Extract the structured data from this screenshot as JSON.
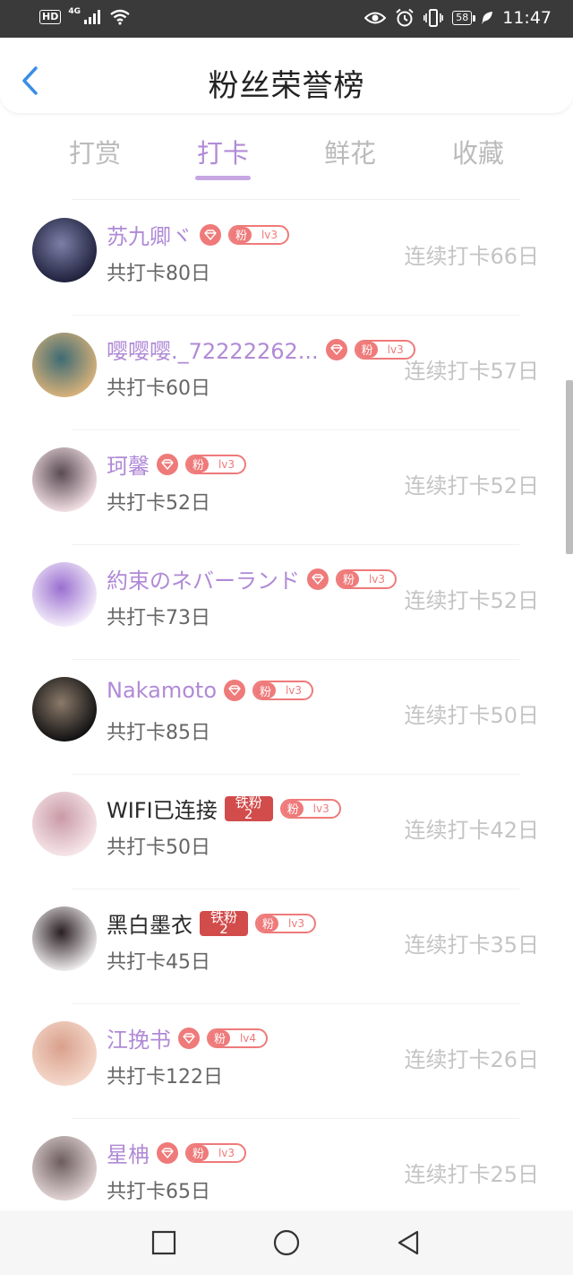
{
  "status_bar": {
    "left_hd": "HD",
    "left_network": "4G",
    "battery": "58",
    "time": "11:47"
  },
  "header": {
    "title": "粉丝荣誉榜"
  },
  "tabs": [
    {
      "label": "打赏",
      "active": false
    },
    {
      "label": "打卡",
      "active": true
    },
    {
      "label": "鲜花",
      "active": false
    },
    {
      "label": "收藏",
      "active": false
    }
  ],
  "badge": {
    "fan_text": "粉",
    "iron_line1": "铁粉",
    "iron_line2": "2"
  },
  "fans": [
    {
      "name": "苏九卿ヾ",
      "badge_type": "diamond",
      "level": "lv3",
      "total": "共打卡80日",
      "streak": "连续打卡66日",
      "avatar_colors": [
        "#1d1f3a",
        "#7d7fa8"
      ]
    },
    {
      "name": "嘤嘤嘤._72222262...",
      "badge_type": "diamond",
      "level": "lv3",
      "total": "共打卡60日",
      "streak": "连续打卡57日",
      "avatar_colors": [
        "#d9b27a",
        "#3e6b73"
      ]
    },
    {
      "name": "珂馨",
      "badge_type": "diamond",
      "level": "lv3",
      "total": "共打卡52日",
      "streak": "连续打卡52日",
      "avatar_colors": [
        "#f3e1e6",
        "#5a4a52"
      ]
    },
    {
      "name": "約束のネバーランド",
      "badge_type": "diamond",
      "level": "lv3",
      "total": "共打卡73日",
      "streak": "连续打卡52日",
      "avatar_colors": [
        "#f6f0fb",
        "#9a6fd0"
      ]
    },
    {
      "name": "Nakamoto",
      "badge_type": "diamond",
      "level": "lv3",
      "total": "共打卡85日",
      "streak": "连续打卡50日",
      "avatar_colors": [
        "#0f0f10",
        "#8b7a6a"
      ]
    },
    {
      "name": "WIFI已连接",
      "badge_type": "iron",
      "level": "lv3",
      "total": "共打卡50日",
      "streak": "连续打卡42日",
      "avatar_colors": [
        "#f7e7ea",
        "#c99aa7"
      ]
    },
    {
      "name": "黑白墨衣",
      "badge_type": "iron",
      "level": "lv3",
      "total": "共打卡45日",
      "streak": "连续打卡35日",
      "avatar_colors": [
        "#f1eeee",
        "#2a1f24"
      ]
    },
    {
      "name": "江挽书",
      "badge_type": "diamond",
      "level": "lv4",
      "total": "共打卡122日",
      "streak": "连续打卡26日",
      "avatar_colors": [
        "#f5d9cc",
        "#d9a08c"
      ]
    },
    {
      "name": "星柟",
      "badge_type": "diamond",
      "level": "lv3",
      "total": "共打卡65日",
      "streak": "连续打卡25日",
      "avatar_colors": [
        "#e4d6d6",
        "#6d5d5f"
      ]
    }
  ]
}
